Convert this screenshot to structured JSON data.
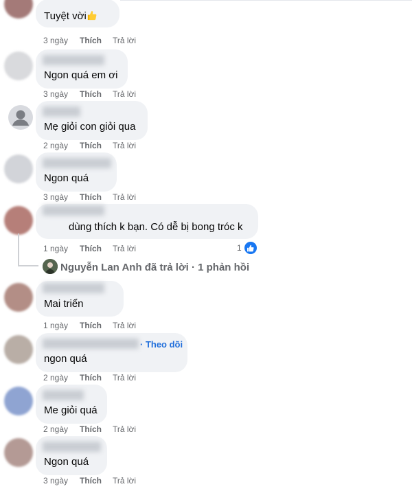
{
  "actions": {
    "like": "Thích",
    "reply": "Trả lời"
  },
  "comments": [
    {
      "text": "Tuyệt vời",
      "time": "3 ngày",
      "avatar_color": "#a47a78"
    },
    {
      "text": "Ngon quá em ơi",
      "time": "3 ngày",
      "avatar_color": "#d9dadd"
    },
    {
      "text": "Mẹ giỏi con giỏi qua",
      "time": "2 ngày",
      "avatar_color": "#d8dadf"
    },
    {
      "text": "Ngon quá",
      "time": "3 ngày",
      "avatar_color": "#d2d4d9"
    },
    {
      "text": "dùng thích k bạn. Có dễ bị bong tróc k",
      "time": "1 ngày",
      "avatar_color": "#b67f79",
      "reaction_count": "1"
    },
    {
      "text": "Mai triển",
      "time": "1 ngày",
      "avatar_color": "#b38e86"
    },
    {
      "text": "ngon quá",
      "time": "2 ngày",
      "avatar_color": "#b9aea6",
      "follow_label": "· Theo dõi"
    },
    {
      "text": "Me giỏi quá",
      "time": "2 ngày",
      "avatar_color": "#8fa4d2"
    },
    {
      "text": "Ngon quá",
      "time": "3 ngày",
      "avatar_color": "#b49a95"
    }
  ],
  "reply_summary": "Nguyễn Lan Anh đã trả lời · 1 phản hồi",
  "colors": {
    "accent": "#1877f2",
    "bubble": "#f0f2f5",
    "meta": "#65676b"
  }
}
